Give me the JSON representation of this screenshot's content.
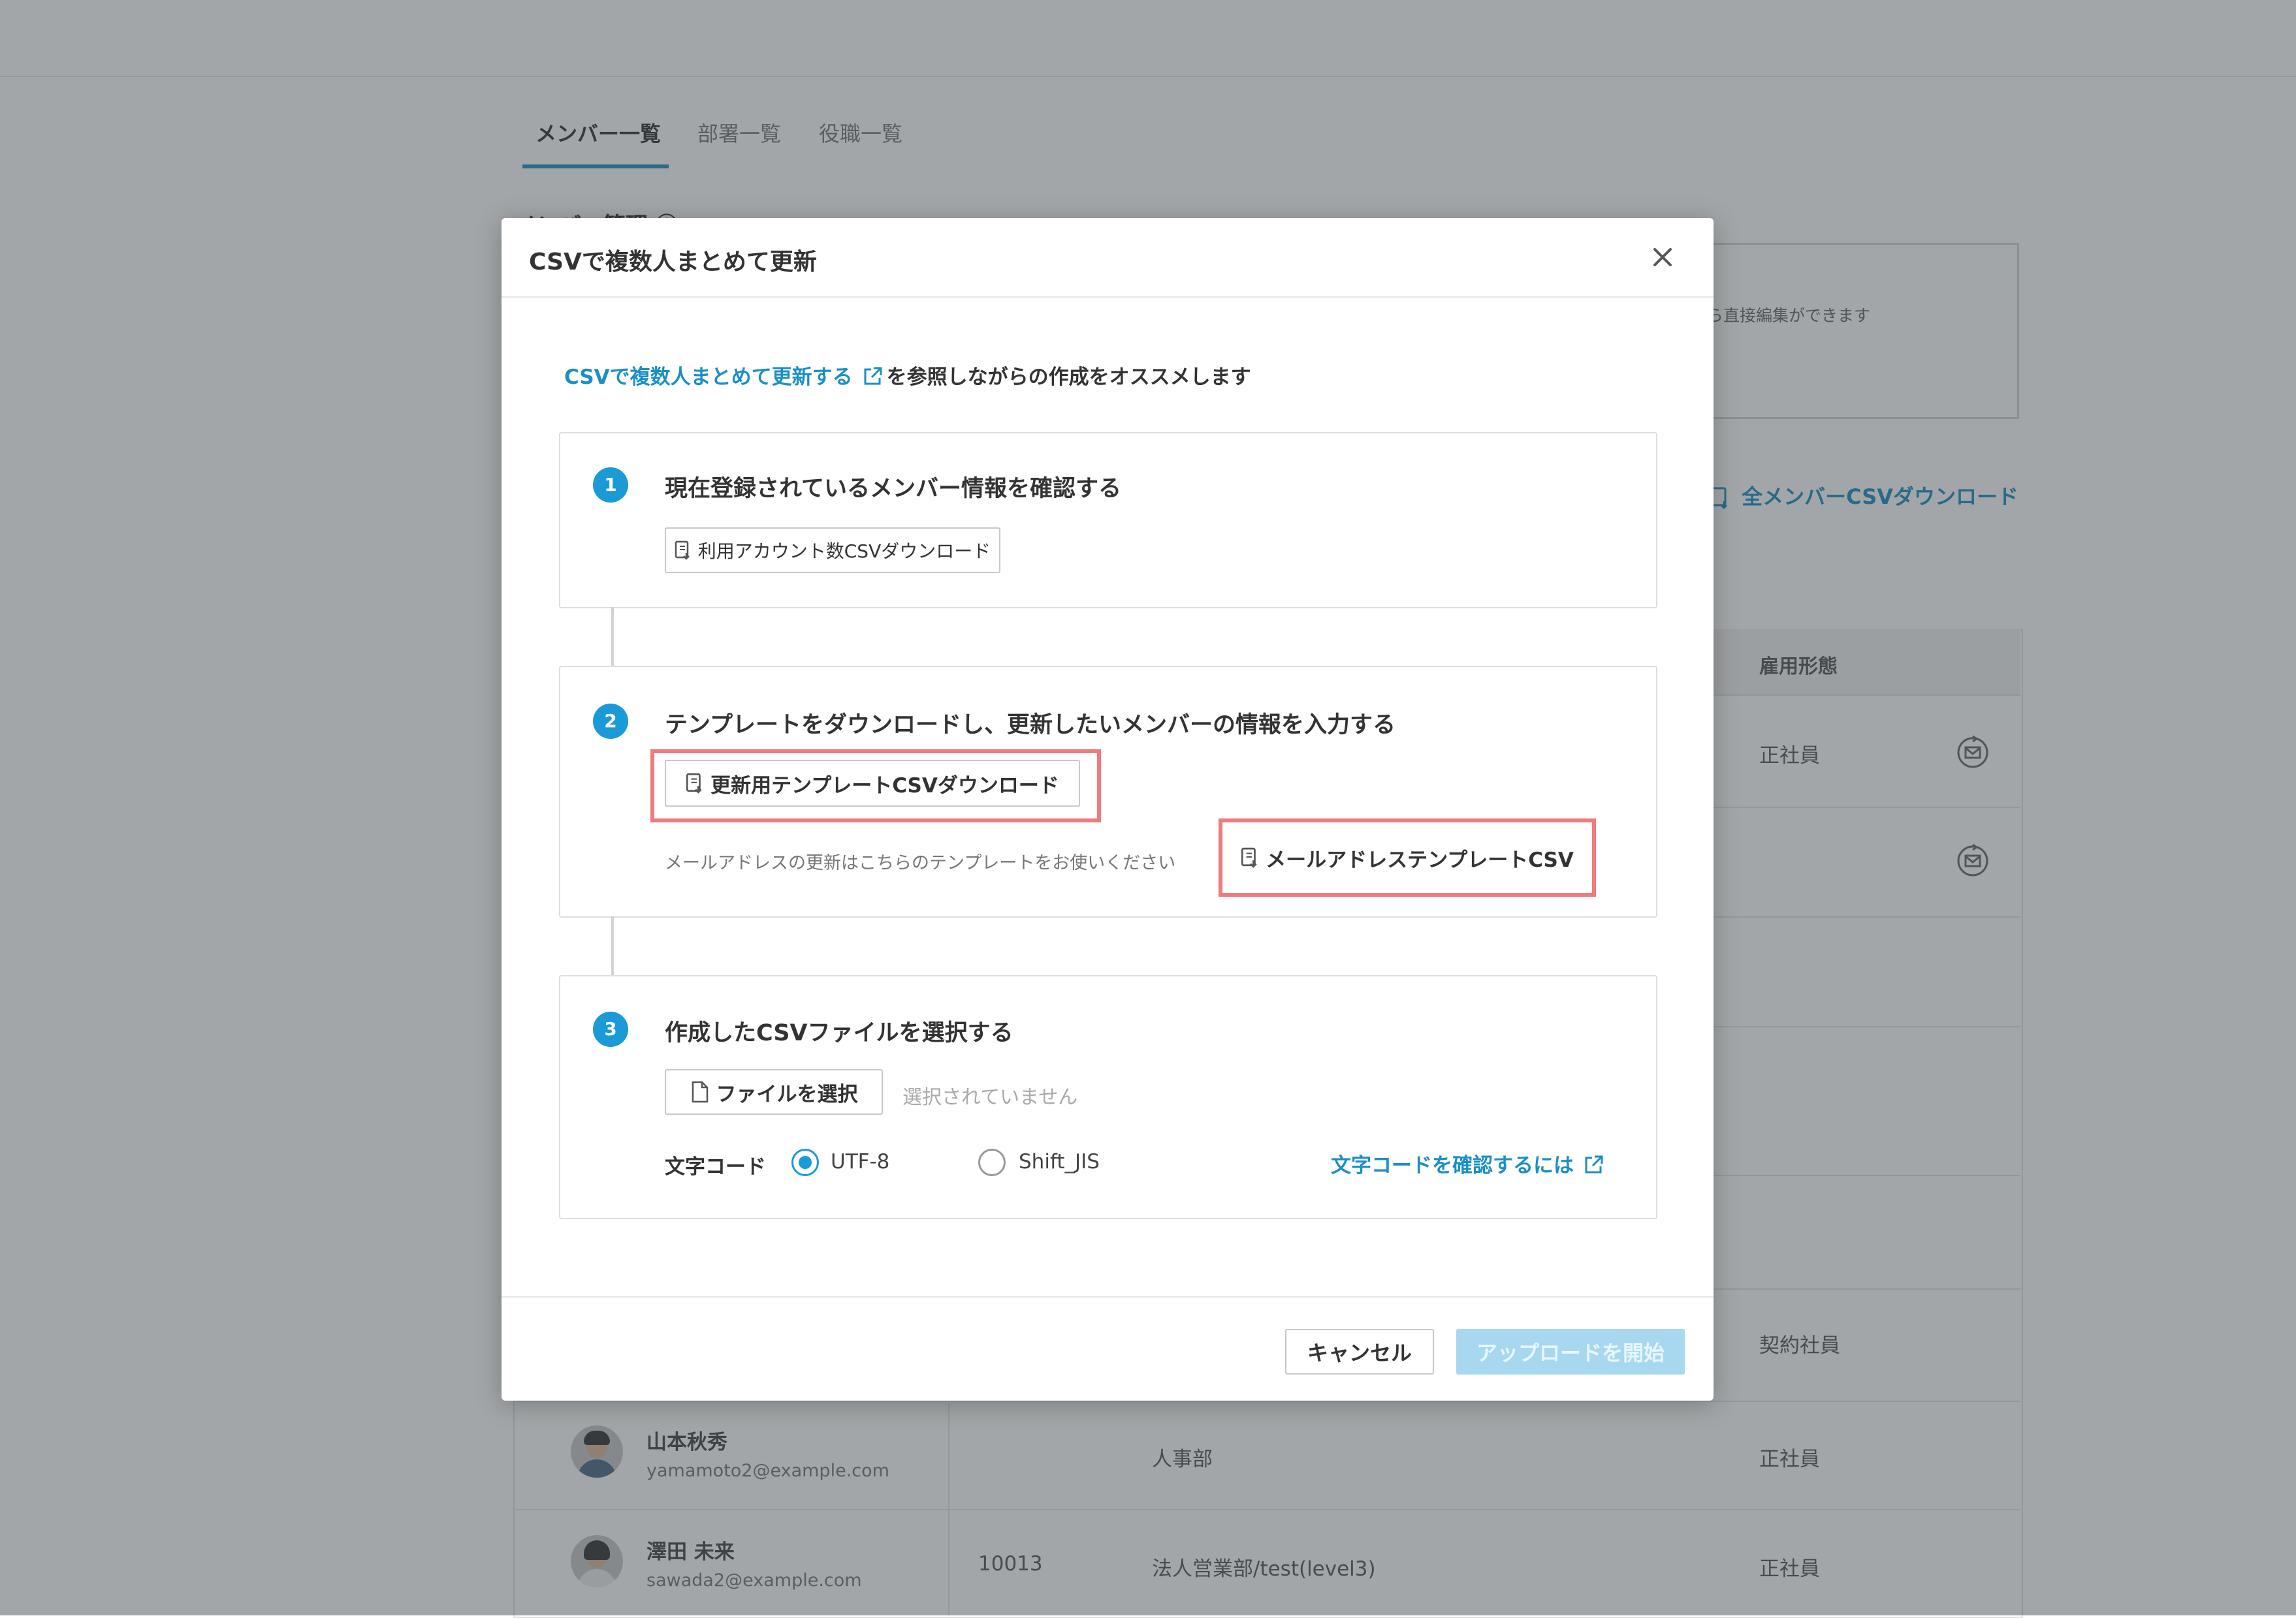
{
  "tabs": [
    "メンバー一覧",
    "部署一覧",
    "役職一覧"
  ],
  "section_title": "メンバー管理 ⓘ",
  "info_text": "ら直接編集ができます",
  "bg_download_link": "全メンバーCSVダウンロード",
  "table": {
    "header_employment": "雇用形態",
    "rows": [
      {
        "employment": "正社員"
      },
      {
        "employment": ""
      },
      {
        "employment": "契約社員"
      },
      {
        "name": "山本秋秀",
        "email": "yamamoto2@example.com",
        "code": "",
        "dept": "人事部",
        "employment": "正社員"
      },
      {
        "name": "澤田 未来",
        "email": "sawada2@example.com",
        "code": "10013",
        "dept": "法人営業部/test(level3)",
        "employment": "正社員"
      }
    ]
  },
  "modal": {
    "title": "CSVで複数人まとめて更新",
    "intro_link": "CSVで複数人まとめて更新する",
    "intro_text": "を参照しながらの作成をオススメします",
    "step1": {
      "num": "1",
      "title": "現在登録されているメンバー情報を確認する",
      "button": "利用アカウント数CSVダウンロード"
    },
    "step2": {
      "num": "2",
      "title": "テンプレートをダウンロードし、更新したいメンバーの情報を入力する",
      "button": "更新用テンプレートCSVダウンロード",
      "note": "メールアドレスの更新はこちらのテンプレートをお使いください",
      "email_button": "メールアドレステンプレートCSV"
    },
    "step3": {
      "num": "3",
      "title": "作成したCSVファイルを選択する",
      "file_button": "ファイルを選択",
      "file_status": "選択されていません",
      "encoding_label": "文字コード",
      "options": [
        "UTF-8",
        "Shift_JIS"
      ],
      "selected": "UTF-8",
      "check_link": "文字コードを確認するには"
    },
    "cancel": "キャンセル",
    "upload": "アップロードを開始"
  },
  "colors": {
    "accent": "#1a9ad6",
    "highlight": "#f07a7c",
    "upload_disabled": "#a8d8f0"
  }
}
